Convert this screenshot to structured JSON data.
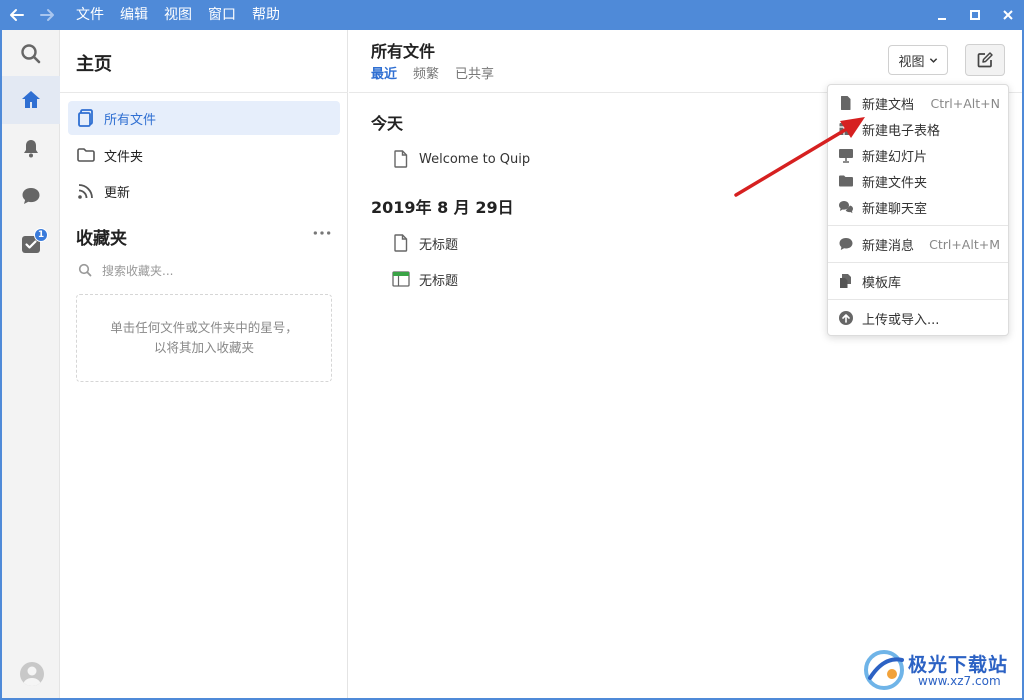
{
  "titlebar": {
    "menu": [
      "文件",
      "编辑",
      "视图",
      "窗口",
      "帮助"
    ],
    "accent": "#4f8ad8"
  },
  "rail": {
    "items": [
      {
        "icon": "search-icon"
      },
      {
        "icon": "home-icon",
        "active": true
      },
      {
        "icon": "bell-icon"
      },
      {
        "icon": "chat-icon"
      },
      {
        "icon": "tasks-icon",
        "badge": "1"
      }
    ]
  },
  "sidebar": {
    "title": "主页",
    "items": [
      {
        "label": "所有文件",
        "icon": "all-files-icon",
        "active": true
      },
      {
        "label": "文件夹",
        "icon": "folder-icon"
      },
      {
        "label": "更新",
        "icon": "updates-icon"
      }
    ],
    "favorites": {
      "title": "收藏夹",
      "search_placeholder": "搜索收藏夹...",
      "empty_text": "单击任何文件或文件夹中的星号，以将其加入收藏夹"
    }
  },
  "main": {
    "title": "所有文件",
    "tabs": [
      {
        "label": "最近",
        "active": true
      },
      {
        "label": "频繁"
      },
      {
        "label": "已共享"
      }
    ],
    "view_button": "视图",
    "sections": [
      {
        "heading": "今天",
        "files": [
          {
            "name": "Welcome to Quip",
            "icon": "document-icon"
          }
        ]
      },
      {
        "heading": "2019年 8 月 29日",
        "files": [
          {
            "name": "无标题",
            "icon": "document-icon"
          },
          {
            "name": "无标题",
            "icon": "spreadsheet-icon"
          }
        ]
      }
    ]
  },
  "dropdown": {
    "items": [
      {
        "label": "新建文档",
        "shortcut": "Ctrl+Alt+N",
        "icon": "new-document-icon"
      },
      {
        "label": "新建电子表格",
        "icon": "new-spreadsheet-icon"
      },
      {
        "label": "新建幻灯片",
        "icon": "new-slides-icon"
      },
      {
        "label": "新建文件夹",
        "icon": "new-folder-icon"
      },
      {
        "label": "新建聊天室",
        "icon": "new-chatroom-icon"
      },
      {
        "label": "新建消息",
        "shortcut": "Ctrl+Alt+M",
        "icon": "new-message-icon"
      },
      {
        "label": "模板库",
        "icon": "template-icon"
      },
      {
        "label": "上传或导入...",
        "icon": "upload-icon"
      }
    ]
  },
  "watermark": {
    "name": "极光下载站",
    "url": "www.xz7.com"
  }
}
